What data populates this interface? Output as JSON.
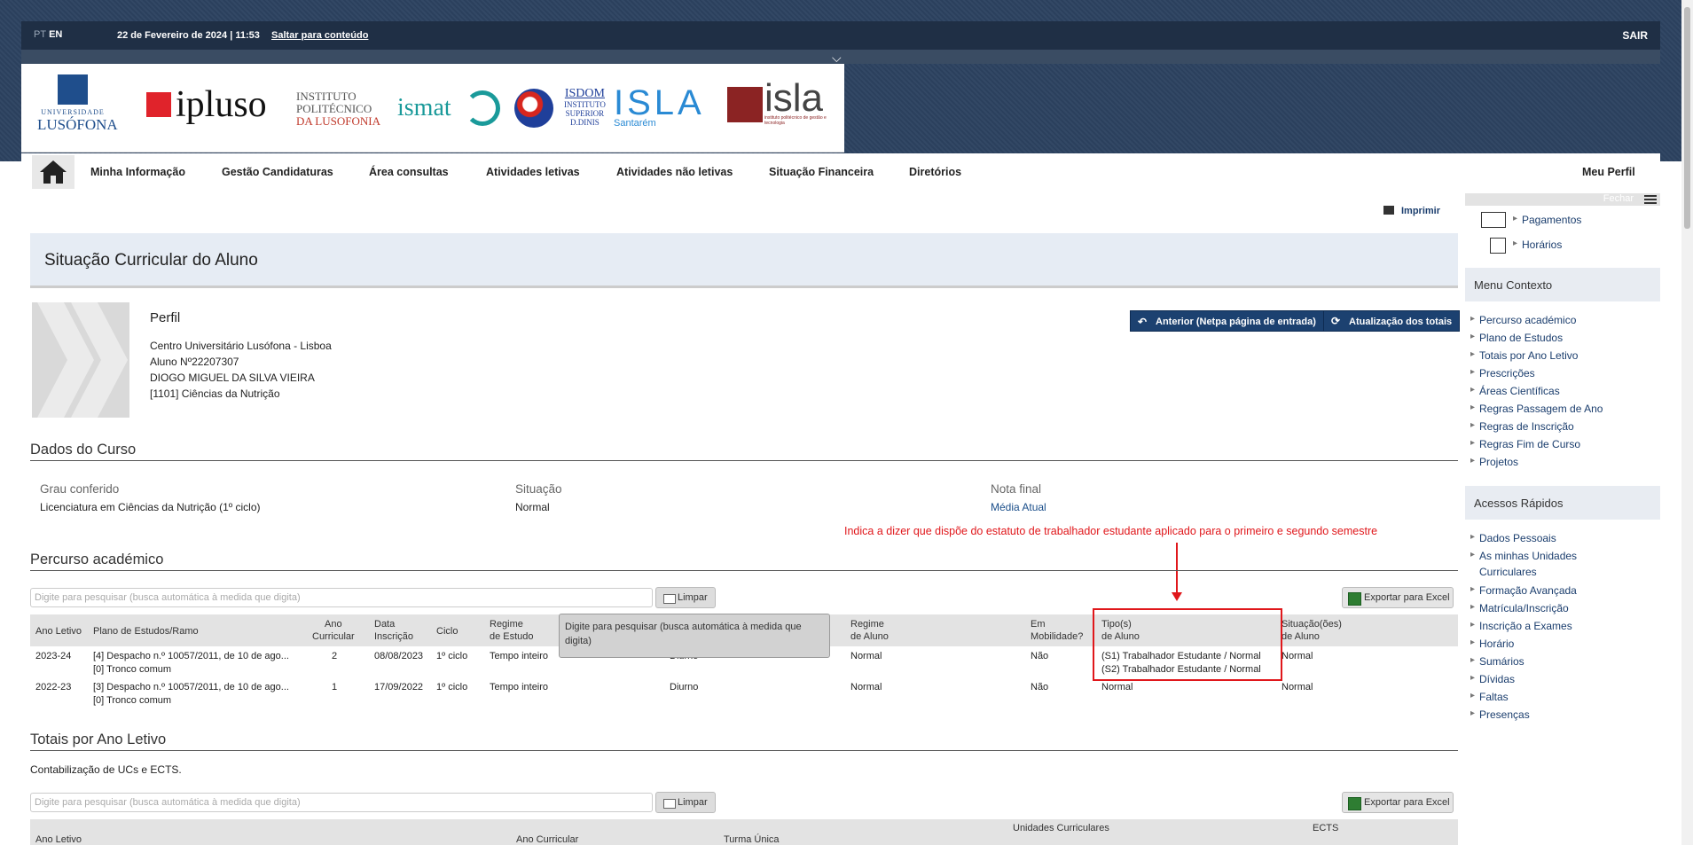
{
  "topbar": {
    "lang_pt": "PT",
    "lang_en": "EN",
    "datetime": "22 de Fevereiro de 2024 | 11:53",
    "skip": "Saltar para conteúdo",
    "logout": "SAIR"
  },
  "logos": {
    "lusofona_top": "UNIVERSIDADE",
    "lusofona_bottom": "LUSÓFONA",
    "ipluso": "ipluso",
    "instituto_1": "INSTITUTO",
    "instituto_2": "POLITÉCNICO",
    "instituto_3": "DA LUSOFONIA",
    "ismat": "ismat",
    "isdom_1": "ISDOM",
    "isdom_2": "INSTITUTO",
    "isdom_3": "SUPERIOR",
    "isdom_4": "D.DINIS",
    "isla1": "ISLA",
    "isla1_sub": "Santarém",
    "isla2": "isla",
    "isla2_sub": "instituto politécnico de gestão e tecnologia"
  },
  "nav": {
    "items": [
      "Minha Informação",
      "Gestão Candidaturas",
      "Área consultas",
      "Atividades letivas",
      "Atividades não letivas",
      "Situação Financeira",
      "Diretórios"
    ],
    "profile": "Meu Perfil"
  },
  "print": "Imprimir",
  "page_title": "Situação Curricular do Aluno",
  "profile": {
    "heading": "Perfil",
    "institution": "Centro Universitário Lusófona - Lisboa",
    "student_no": "Aluno Nº22207307",
    "name": "DIOGO MIGUEL DA SILVA VIEIRA",
    "course": "[1101] Ciências da Nutrição"
  },
  "buttons": {
    "previous": "Anterior (Netpa página de entrada)",
    "update": "Atualização dos totais"
  },
  "course_data": {
    "heading": "Dados do Curso",
    "degree_label": "Grau conferido",
    "degree_value": "Licenciatura em Ciências da Nutrição (1º ciclo)",
    "status_label": "Situação",
    "status_value": "Normal",
    "grade_label": "Nota final",
    "grade_value": "Média Atual"
  },
  "annotation": "Indica a dizer que dispõe do estatuto de trabalhador estudante aplicado para o primeiro e segundo semestre",
  "percurso": {
    "heading": "Percurso académico",
    "search_placeholder": "Digite para pesquisar (busca automática à medida que digita)",
    "clear": "Limpar",
    "export": "Exportar para Excel",
    "tooltip": "Digite para pesquisar (busca automática à medida que digita)",
    "columns": [
      "Ano Letivo",
      "Plano de Estudos/Ramo",
      "Ano Curricular",
      "Data Inscrição",
      "Ciclo",
      "Regime de Estudo",
      "Regime de Aluno",
      "Em Mobilidade?",
      "Tipo(s) de Aluno",
      "Situação(ões) de Aluno"
    ],
    "col_lines": [
      [
        "Ano Letivo"
      ],
      [
        "Plano de Estudos/Ramo"
      ],
      [
        "Ano",
        "Curricular"
      ],
      [
        "Data",
        "Inscrição"
      ],
      [
        "Ciclo"
      ],
      [
        "Regime",
        "de Estudo"
      ],
      [
        "Regime",
        "de Aluno"
      ],
      [
        "Em",
        "Mobilidade?"
      ],
      [
        "Tipo(s)",
        "de Aluno"
      ],
      [
        "Situação(ões)",
        "de Aluno"
      ]
    ],
    "rows": [
      {
        "ano": "2023-24",
        "plano_1": "[4] Despacho n.º 10057/2011, de 10 de ago...",
        "plano_2": "[0] Tronco comum",
        "ano_curr": "2",
        "data": "08/08/2023",
        "ciclo": "1º ciclo",
        "regime_estudo": "Tempo inteiro",
        "turno": "Diurno",
        "regime_aluno": "Normal",
        "mobilidade": "Não",
        "tipo_1": "(S1) Trabalhador Estudante / Normal",
        "tipo_2": "(S2) Trabalhador Estudante / Normal",
        "situacao": "Normal"
      },
      {
        "ano": "2022-23",
        "plano_1": "[3] Despacho n.º 10057/2011, de 10 de ago...",
        "plano_2": "[0] Tronco comum",
        "ano_curr": "1",
        "data": "17/09/2022",
        "ciclo": "1º ciclo",
        "regime_estudo": "Tempo inteiro",
        "turno": "Diurno",
        "regime_aluno": "Normal",
        "mobilidade": "Não",
        "tipo_1": "Normal",
        "tipo_2": "",
        "situacao": "Normal"
      }
    ]
  },
  "totais": {
    "heading": "Totais por Ano Letivo",
    "subtitle": "Contabilização de UCs e ECTS.",
    "search_placeholder": "Digite para pesquisar (busca automática à medida que digita)",
    "clear": "Limpar",
    "export": "Exportar para Excel",
    "col_ano": "Ano Letivo",
    "col_ano_curr": "Ano Curricular",
    "col_turma": "Turma Única",
    "col_uc": "Unidades Curriculares",
    "col_ects": "ECTS"
  },
  "sidebar": {
    "close": "Fechar",
    "top_links": [
      "Pagamentos",
      "Horários"
    ],
    "menu_title": "Menu Contexto",
    "menu": [
      "Percurso académico",
      "Plano de Estudos",
      "Totais por Ano Letivo",
      "Prescrições",
      "Áreas Científicas",
      "Regras Passagem de Ano",
      "Regras de Inscrição",
      "Regras Fim de Curso",
      "Projetos"
    ],
    "quick_title": "Acessos Rápidos",
    "quick_unidades_1": "As minhas Unidades",
    "quick_unidades_2": "Curriculares",
    "quick": [
      "Dados Pessoais",
      "Formação Avançada",
      "Matrícula/Inscrição",
      "Inscrição a Exames",
      "Horário",
      "Sumários",
      "Dívidas",
      "Faltas",
      "Presenças"
    ]
  },
  "colors": {
    "accent": "#1c4170",
    "annotation": "#e0171b",
    "header_bg": "#2c4260"
  }
}
